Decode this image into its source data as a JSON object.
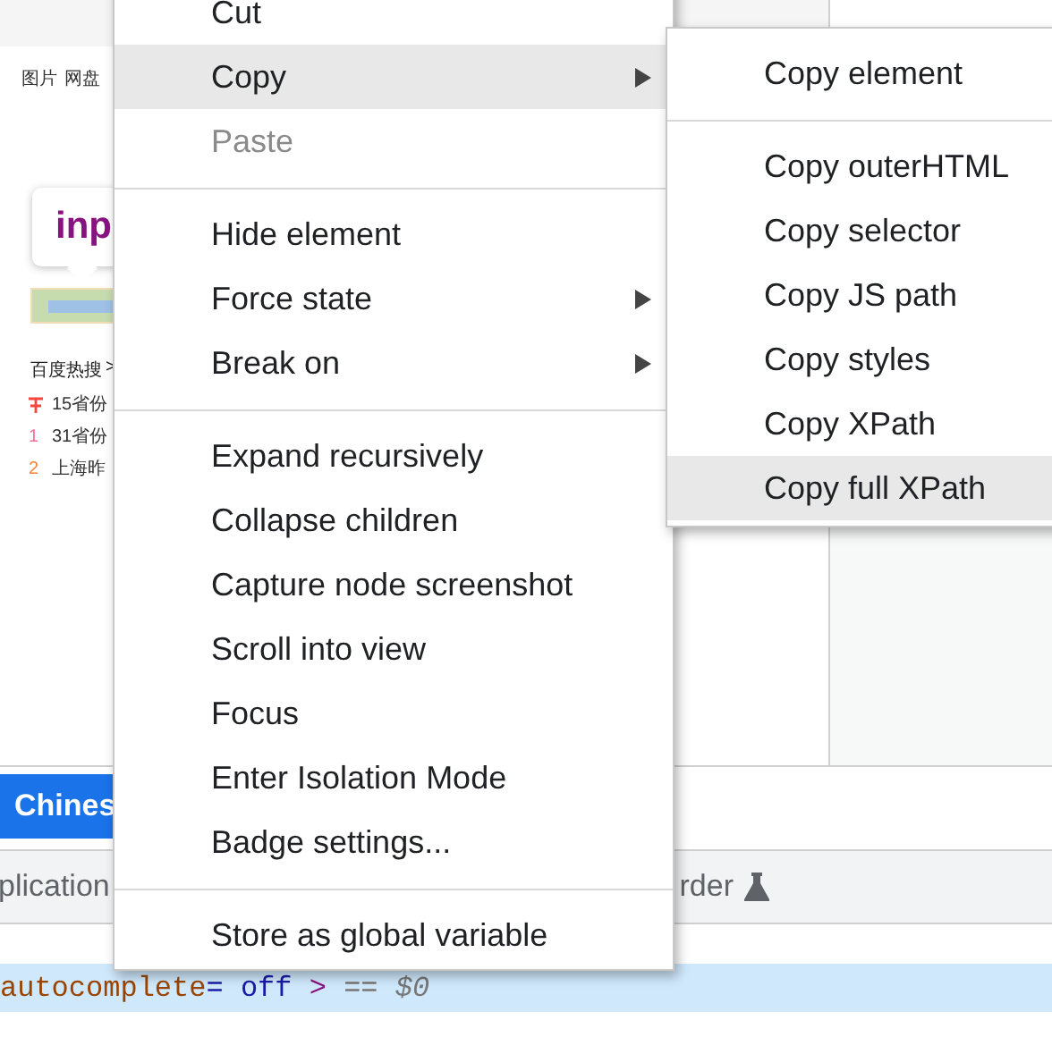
{
  "page_preview": {
    "nav_links": [
      "图片",
      "网盘"
    ],
    "tooltip": "inp",
    "hot_search": {
      "title": "百度热搜",
      "arrow": ">",
      "items": [
        {
          "kind": "pinned",
          "color": "#f5453d",
          "text": "15省份"
        },
        {
          "kind": "number",
          "rank": "1",
          "color": "#f5709a",
          "text": "31省份"
        },
        {
          "kind": "number",
          "rank": "2",
          "color": "#f5853d",
          "text": "上海昨"
        }
      ]
    }
  },
  "devtools": {
    "language_button": "Chines",
    "tabs": [
      "plication",
      "rder"
    ],
    "code_line": {
      "attribute": "autocomplete",
      "equals": "=",
      "value": "off",
      "close": ">",
      "marker": "== $0"
    }
  },
  "context_menu": {
    "items": [
      {
        "kind": "item",
        "label": "Cut",
        "disabled": false,
        "selected": false,
        "submenu": false
      },
      {
        "kind": "item",
        "label": "Copy",
        "disabled": false,
        "selected": true,
        "submenu": true
      },
      {
        "kind": "item",
        "label": "Paste",
        "disabled": true,
        "selected": false,
        "submenu": false
      },
      {
        "kind": "separator"
      },
      {
        "kind": "item",
        "label": "Hide element",
        "disabled": false,
        "selected": false,
        "submenu": false
      },
      {
        "kind": "item",
        "label": "Force state",
        "disabled": false,
        "selected": false,
        "submenu": true
      },
      {
        "kind": "item",
        "label": "Break on",
        "disabled": false,
        "selected": false,
        "submenu": true
      },
      {
        "kind": "separator"
      },
      {
        "kind": "item",
        "label": "Expand recursively",
        "disabled": false,
        "selected": false,
        "submenu": false
      },
      {
        "kind": "item",
        "label": "Collapse children",
        "disabled": false,
        "selected": false,
        "submenu": false
      },
      {
        "kind": "item",
        "label": "Capture node screenshot",
        "disabled": false,
        "selected": false,
        "submenu": false
      },
      {
        "kind": "item",
        "label": "Scroll into view",
        "disabled": false,
        "selected": false,
        "submenu": false
      },
      {
        "kind": "item",
        "label": "Focus",
        "disabled": false,
        "selected": false,
        "submenu": false
      },
      {
        "kind": "item",
        "label": "Enter Isolation Mode",
        "disabled": false,
        "selected": false,
        "submenu": false
      },
      {
        "kind": "item",
        "label": "Badge settings...",
        "disabled": false,
        "selected": false,
        "submenu": false
      },
      {
        "kind": "separator"
      },
      {
        "kind": "item",
        "label": "Store as global variable",
        "disabled": false,
        "selected": false,
        "submenu": false
      }
    ]
  },
  "copy_submenu": {
    "items": [
      {
        "kind": "item",
        "label": "Copy element",
        "disabled": false,
        "selected": false,
        "submenu": false
      },
      {
        "kind": "separator"
      },
      {
        "kind": "item",
        "label": "Copy outerHTML",
        "disabled": false,
        "selected": false,
        "submenu": false
      },
      {
        "kind": "item",
        "label": "Copy selector",
        "disabled": false,
        "selected": false,
        "submenu": false
      },
      {
        "kind": "item",
        "label": "Copy JS path",
        "disabled": false,
        "selected": false,
        "submenu": false
      },
      {
        "kind": "item",
        "label": "Copy styles",
        "disabled": false,
        "selected": false,
        "submenu": false
      },
      {
        "kind": "item",
        "label": "Copy XPath",
        "disabled": false,
        "selected": false,
        "submenu": false
      },
      {
        "kind": "item",
        "label": "Copy full XPath",
        "disabled": false,
        "selected": true,
        "submenu": false
      }
    ]
  }
}
